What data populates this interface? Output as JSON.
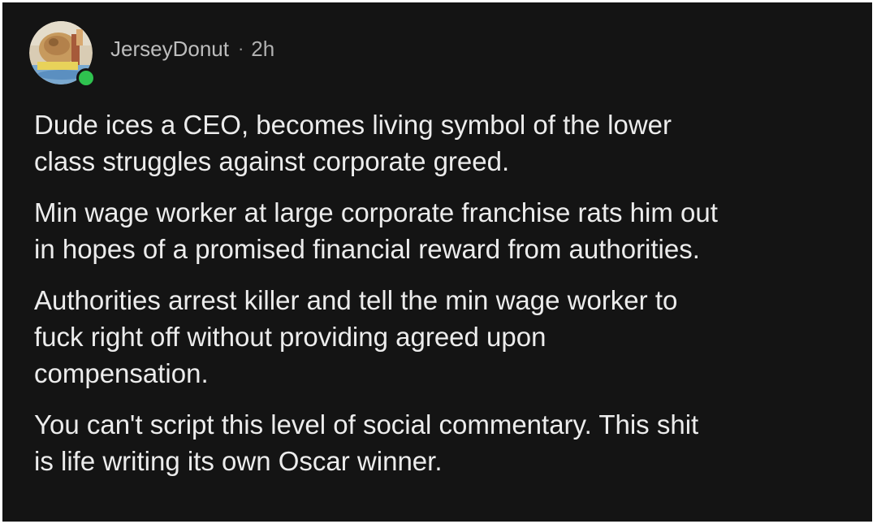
{
  "post": {
    "username": "JerseyDonut",
    "separator": "·",
    "time": "2h",
    "avatar_icon": "user-avatar-icon",
    "online_status_color": "#2fc24f",
    "paragraphs": [
      "Dude ices a CEO, becomes living symbol of the lower\nclass struggles against corporate greed.",
      "Min wage worker at large corporate franchise rats him out\nin hopes of a promised financial reward from authorities.",
      "Authorities arrest killer and tell the min wage worker to\nfuck right off without providing agreed upon\ncompensation.",
      "You can't script this level of social commentary. This shit\nis life writing its own Oscar winner."
    ]
  }
}
